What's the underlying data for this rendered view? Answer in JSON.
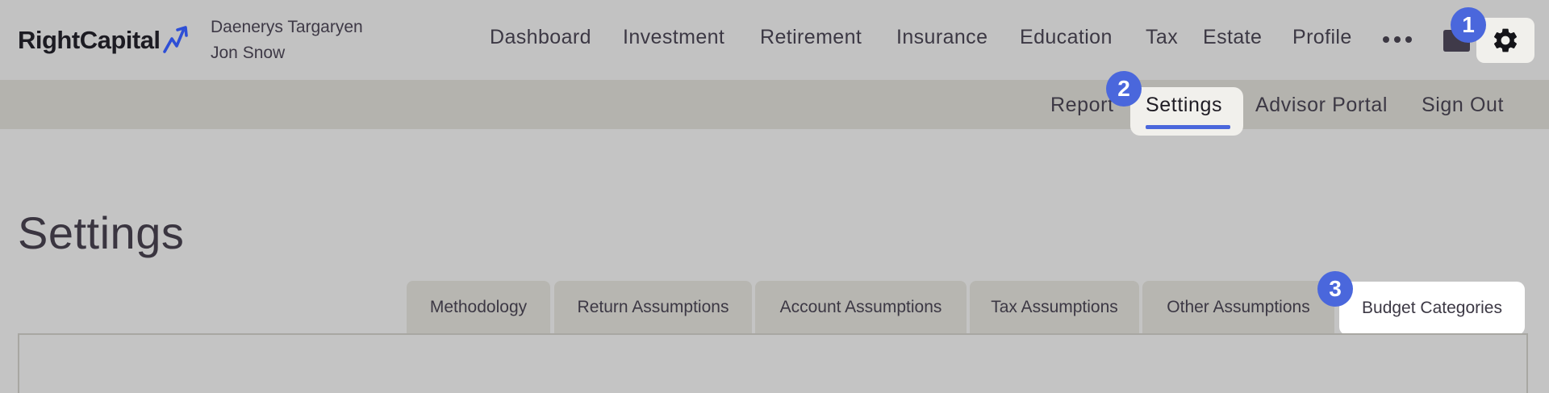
{
  "brand": {
    "name": "RightCapital",
    "accent": "#4a67dc"
  },
  "clients": [
    "Daenerys Targaryen",
    "Jon Snow"
  ],
  "main_nav": [
    "Dashboard",
    "Investment",
    "Retirement",
    "Insurance",
    "Education",
    "Tax",
    "Estate",
    "Profile"
  ],
  "header_icons": {
    "more": "more-dots-icon",
    "folder": "folder-icon",
    "settings": "gear-icon"
  },
  "sub_nav": [
    "Report",
    "Settings",
    "Advisor Portal",
    "Sign Out"
  ],
  "sub_nav_active": "Settings",
  "page": {
    "title": "Settings"
  },
  "tabs": [
    "Methodology",
    "Return Assumptions",
    "Account Assumptions",
    "Tax Assumptions",
    "Other Assumptions",
    "Budget Categories"
  ],
  "tabs_active": "Budget Categories",
  "step_badges": [
    "1",
    "2",
    "3"
  ]
}
